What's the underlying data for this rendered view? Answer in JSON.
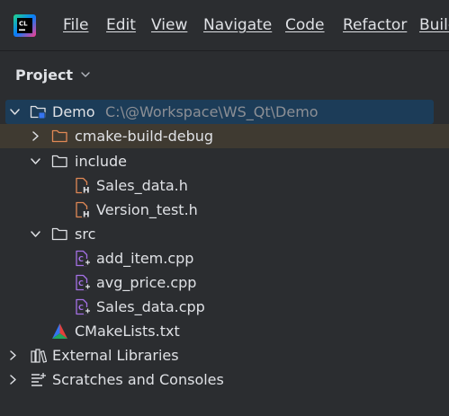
{
  "menu": {
    "file": "File",
    "edit": "Edit",
    "view": "View",
    "navigate": "Navigate",
    "code": "Code",
    "refactor": "Refactor",
    "build": "Build"
  },
  "project_panel": {
    "title": "Project"
  },
  "tree": {
    "root": {
      "label": "Demo",
      "path": "C:\\@Workspace\\WS_Qt\\Demo"
    },
    "cmake_build_debug": "cmake-build-debug",
    "include": "include",
    "include_files": [
      "Sales_data.h",
      "Version_test.h"
    ],
    "src": "src",
    "src_files": [
      "add_item.cpp",
      "avg_price.cpp",
      "Sales_data.cpp"
    ],
    "cmakelists": "CMakeLists.txt",
    "external_libraries": "External Libraries",
    "scratches": "Scratches and Consoles"
  },
  "colors": {
    "background": "#2b2d30",
    "selection": "#1c3c58",
    "excluded_row": "#3f3a31",
    "text": "#dfe1e5",
    "path_text": "#8c8f95"
  }
}
